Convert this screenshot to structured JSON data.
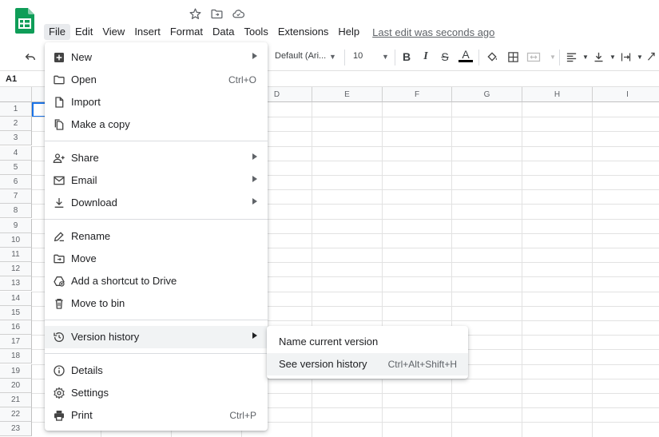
{
  "menubar": {
    "items": [
      "File",
      "Edit",
      "View",
      "Insert",
      "Format",
      "Data",
      "Tools",
      "Extensions",
      "Help"
    ],
    "active": "File",
    "last_edit": "Last edit was seconds ago"
  },
  "toolbar": {
    "font": "Default (Ari...",
    "font_size": "10",
    "underline_color": "#000000"
  },
  "namebox": "A1",
  "grid": {
    "columns": [
      "D",
      "E",
      "F",
      "G",
      "H",
      "I"
    ],
    "rows": [
      "1",
      "2",
      "3",
      "4",
      "5",
      "6",
      "7",
      "8",
      "9",
      "10",
      "11",
      "12",
      "13",
      "14",
      "15",
      "16",
      "17",
      "18",
      "19",
      "20",
      "21",
      "22",
      "23"
    ]
  },
  "file_menu": {
    "items": [
      {
        "label": "New",
        "icon": "plus-box-icon",
        "submenu": true
      },
      {
        "label": "Open",
        "icon": "folder-icon",
        "shortcut": "Ctrl+O"
      },
      {
        "label": "Import",
        "icon": "file-import-icon"
      },
      {
        "label": "Make a copy",
        "icon": "copy-icon"
      },
      {
        "label": "Share",
        "icon": "person-add-icon",
        "submenu": true
      },
      {
        "label": "Email",
        "icon": "email-icon",
        "submenu": true
      },
      {
        "label": "Download",
        "icon": "download-icon",
        "submenu": true
      },
      {
        "label": "Rename",
        "icon": "rename-icon"
      },
      {
        "label": "Move",
        "icon": "move-folder-icon"
      },
      {
        "label": "Add a shortcut to Drive",
        "icon": "drive-shortcut-icon"
      },
      {
        "label": "Move to bin",
        "icon": "trash-icon"
      },
      {
        "label": "Version history",
        "icon": "history-icon",
        "submenu": true
      },
      {
        "label": "Details",
        "icon": "info-icon"
      },
      {
        "label": "Settings",
        "icon": "gear-icon"
      },
      {
        "label": "Print",
        "icon": "printer-icon",
        "shortcut": "Ctrl+P"
      }
    ]
  },
  "version_submenu": {
    "items": [
      {
        "label": "Name current version"
      },
      {
        "label": "See version history",
        "shortcut": "Ctrl+Alt+Shift+H"
      }
    ]
  },
  "colors": {
    "sheets_green": "#0f9d58",
    "selection_blue": "#1a73e8",
    "hover_gray": "#f1f3f4"
  }
}
